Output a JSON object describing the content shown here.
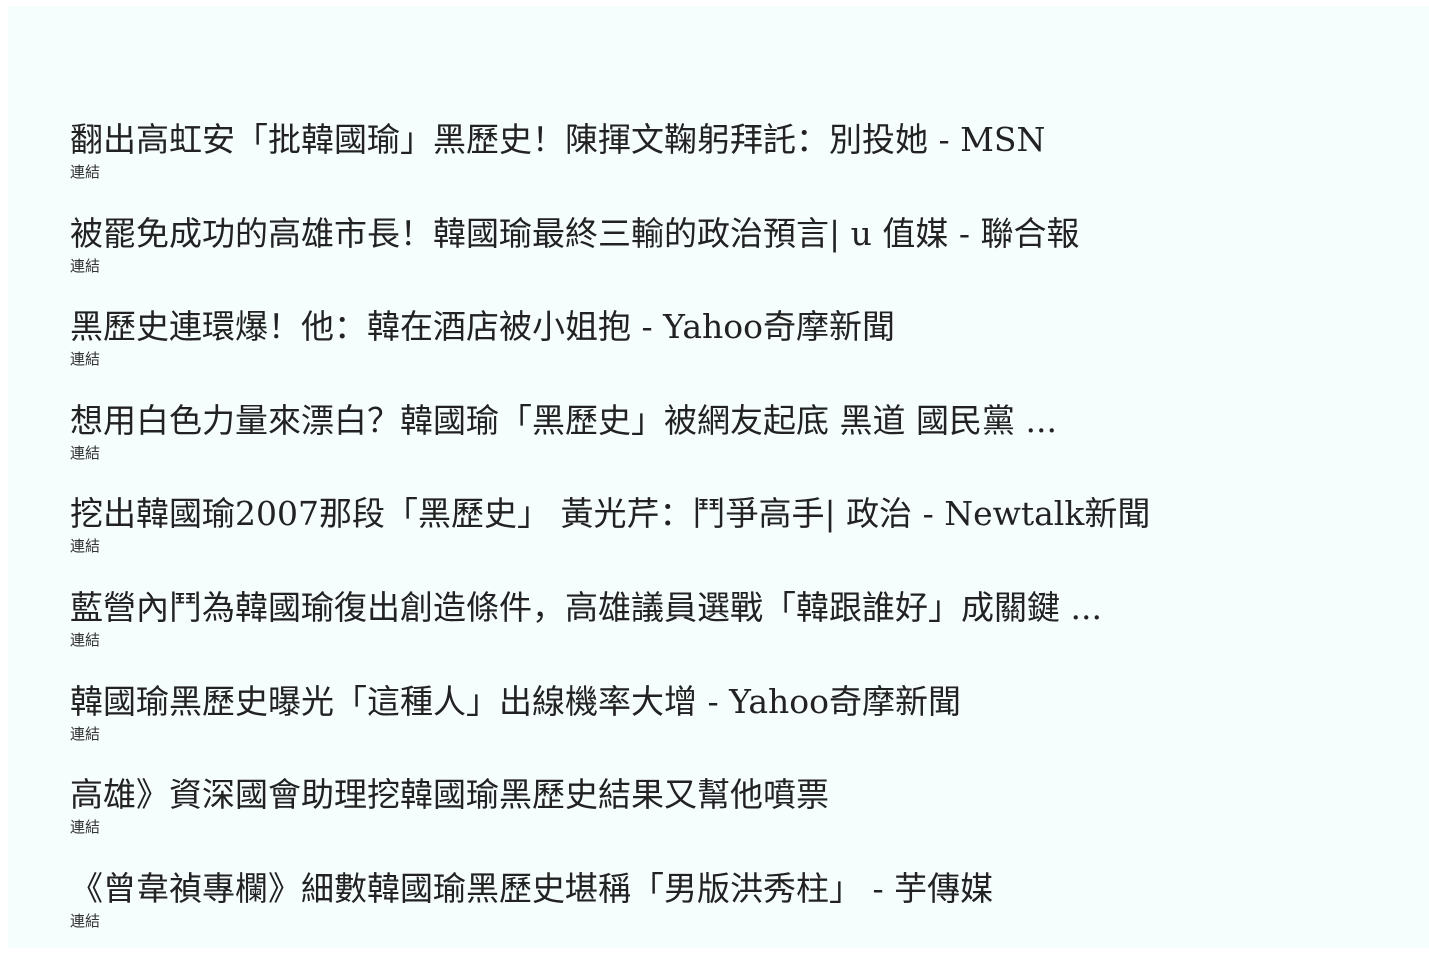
{
  "results": [
    {
      "title": "翻出高虹安「批韓國瑜」黑歷史！陳揮文鞠躬拜託：別投她 - MSN",
      "link_label": "連結"
    },
    {
      "title": "被罷免成功的高雄市長！韓國瑜最終三輸的政治預言| u 值媒 - 聯合報",
      "link_label": "連結"
    },
    {
      "title": "黑歷史連環爆！他：韓在酒店被小姐抱 - Yahoo奇摩新聞",
      "link_label": "連結"
    },
    {
      "title": "想用白色力量來漂白？韓國瑜「黑歷史」被網友起底 黑道 國民黨 ...",
      "link_label": "連結"
    },
    {
      "title": "挖出韓國瑜2007那段「黑歷史」 黃光芹：鬥爭高手| 政治 - Newtalk新聞",
      "link_label": "連結"
    },
    {
      "title": "藍營內鬥為韓國瑜復出創造條件，高雄議員選戰「韓跟誰好」成關鍵 ...",
      "link_label": "連結"
    },
    {
      "title": "韓國瑜黑歷史曝光「這種人」出線機率大增 - Yahoo奇摩新聞",
      "link_label": "連結"
    },
    {
      "title": "高雄》資深國會助理挖韓國瑜黑歷史結果又幫他噴票",
      "link_label": "連結"
    },
    {
      "title": "《曾韋禎專欄》細數韓國瑜黑歷史堪稱「男版洪秀柱」 - 芋傳媒",
      "link_label": "連結"
    }
  ]
}
